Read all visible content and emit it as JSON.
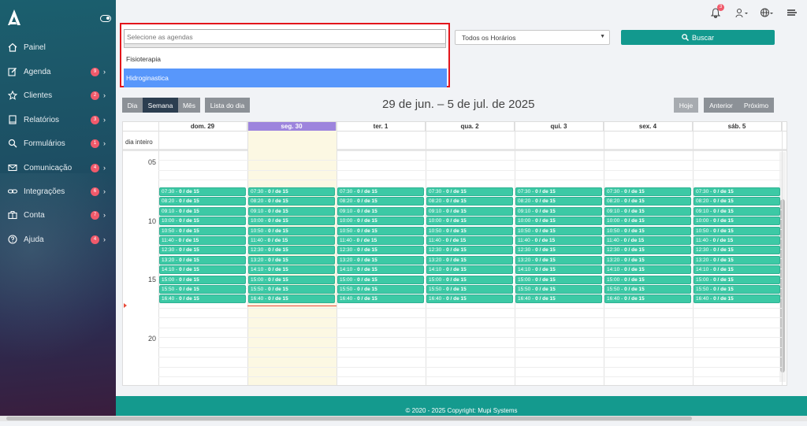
{
  "sidebar": {
    "items": [
      {
        "label": "Painel",
        "icon": "home-icon",
        "badge": ""
      },
      {
        "label": "Agenda",
        "icon": "edit-icon",
        "badge": "9"
      },
      {
        "label": "Clientes",
        "icon": "star-icon",
        "badge": "2"
      },
      {
        "label": "Relatórios",
        "icon": "book-icon",
        "badge": "3"
      },
      {
        "label": "Formulários",
        "icon": "search-icon",
        "badge": "1"
      },
      {
        "label": "Comunicação",
        "icon": "mail-icon",
        "badge": "4"
      },
      {
        "label": "Integrações",
        "icon": "link-icon",
        "badge": "6"
      },
      {
        "label": "Conta",
        "icon": "briefcase-icon",
        "badge": "7"
      },
      {
        "label": "Ajuda",
        "icon": "help-icon",
        "badge": "4"
      }
    ]
  },
  "header": {
    "notification_count": "3"
  },
  "filters": {
    "agenda_placeholder": "Selecione as agendas",
    "agenda_options": [
      {
        "label": "Fisioterapia"
      },
      {
        "label": "Hidroginastica"
      }
    ],
    "horarios_value": "Todos os Horários",
    "buscar_label": "Buscar"
  },
  "calendar": {
    "views": {
      "day": "Dia",
      "week": "Semana",
      "month": "Mês",
      "list": "Lista do dia"
    },
    "title": "29 de jun. – 5 de jul. de 2025",
    "today_label": "Hoje",
    "prev_label": "Anterior",
    "next_label": "Próximo",
    "allday_label": "dia inteiro",
    "days": [
      "dom. 29",
      "seg. 30",
      "ter. 1",
      "qua. 2",
      "qui. 3",
      "sex. 4",
      "sáb. 5"
    ],
    "hours": [
      "05",
      "10",
      "15",
      "20"
    ],
    "slots": [
      {
        "time": "07:30",
        "text": "0 / de 15"
      },
      {
        "time": "08:20",
        "text": "0 / de 15"
      },
      {
        "time": "09:10",
        "text": "0 / de 15"
      },
      {
        "time": "10:00",
        "text": "0 / de 15"
      },
      {
        "time": "10:50",
        "text": "0 / de 15"
      },
      {
        "time": "11:40",
        "text": "0 / de 15"
      },
      {
        "time": "12:30",
        "text": "0 / de 15"
      },
      {
        "time": "13:20",
        "text": "0 / de 15"
      },
      {
        "time": "14:10",
        "text": "0 / de 15"
      },
      {
        "time": "15:00",
        "text": "0 / de 15"
      },
      {
        "time": "15:50",
        "text": "0 / de 15"
      },
      {
        "time": "16:40",
        "text": "0 / de 15"
      }
    ]
  },
  "footer": {
    "text": "© 2020 - 2025 Copyright: Mupi Systems"
  },
  "colors": {
    "accent": "#12998e",
    "slot": "#3cc9a5",
    "today_header": "#9d84dd",
    "today_bg": "#fcf8e3",
    "badge": "#f05a6b"
  }
}
